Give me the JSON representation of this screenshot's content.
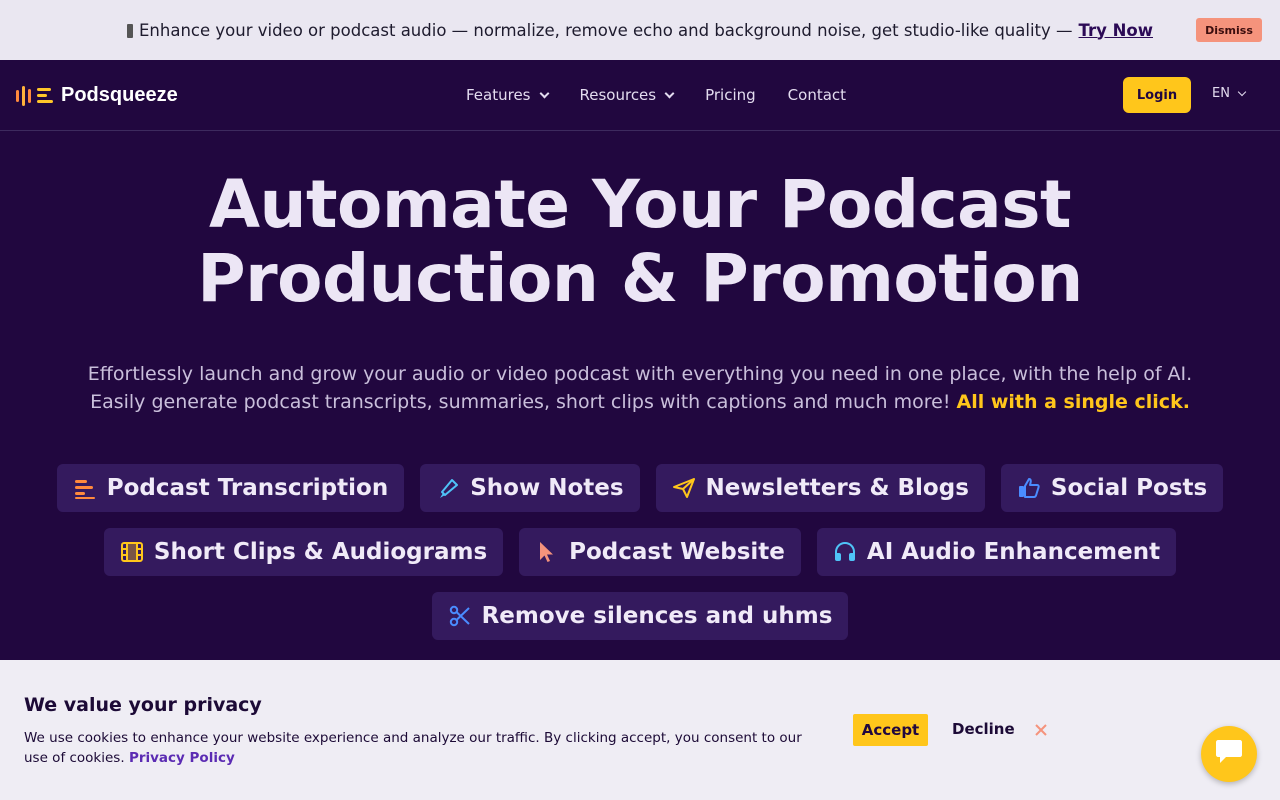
{
  "announcement": {
    "text": "Enhance your video or podcast audio — normalize, remove echo and background noise, get studio-like quality —",
    "cta": "Try Now",
    "dismiss": "Dismiss"
  },
  "navbar": {
    "brand": "Podsqueeze",
    "items": [
      {
        "label": "Features",
        "dropdown": true
      },
      {
        "label": "Resources",
        "dropdown": true
      },
      {
        "label": "Pricing",
        "dropdown": false
      },
      {
        "label": "Contact",
        "dropdown": false
      }
    ],
    "login": "Login",
    "language": "EN"
  },
  "hero": {
    "title_line1": "Automate Your Podcast",
    "title_line2": "Production & Promotion",
    "subtitle_line1": "Effortlessly launch and grow your audio or video podcast with everything you need in one place, with the help of AI.",
    "subtitle_line2": "Easily generate podcast transcripts, summaries, short clips with captions and much more!",
    "subtitle_highlight": "All with a single click."
  },
  "features": [
    {
      "label": "Podcast Transcription",
      "icon": "lines-icon"
    },
    {
      "label": "Show Notes",
      "icon": "highlighter-icon"
    },
    {
      "label": "Newsletters & Blogs",
      "icon": "paper-plane-icon"
    },
    {
      "label": "Social Posts",
      "icon": "thumbs-up-icon"
    },
    {
      "label": "Short Clips & Audiograms",
      "icon": "film-icon"
    },
    {
      "label": "Podcast Website",
      "icon": "cursor-icon"
    },
    {
      "label": "AI Audio Enhancement",
      "icon": "headphones-icon"
    },
    {
      "label": "Remove silences and uhms",
      "icon": "scissors-icon"
    }
  ],
  "cookie": {
    "title": "We value your privacy",
    "body": "We use cookies to enhance your website experience and analyze our traffic. By clicking accept, you consent to our use of cookies.",
    "policy_link": "Privacy Policy",
    "accept": "Accept",
    "decline": "Decline"
  },
  "colors": {
    "background": "#21073f",
    "accent": "#ffc61b",
    "chip": "#341a5e",
    "announcement_bg": "#eae7f1",
    "dismiss_bg": "#f5937c"
  }
}
